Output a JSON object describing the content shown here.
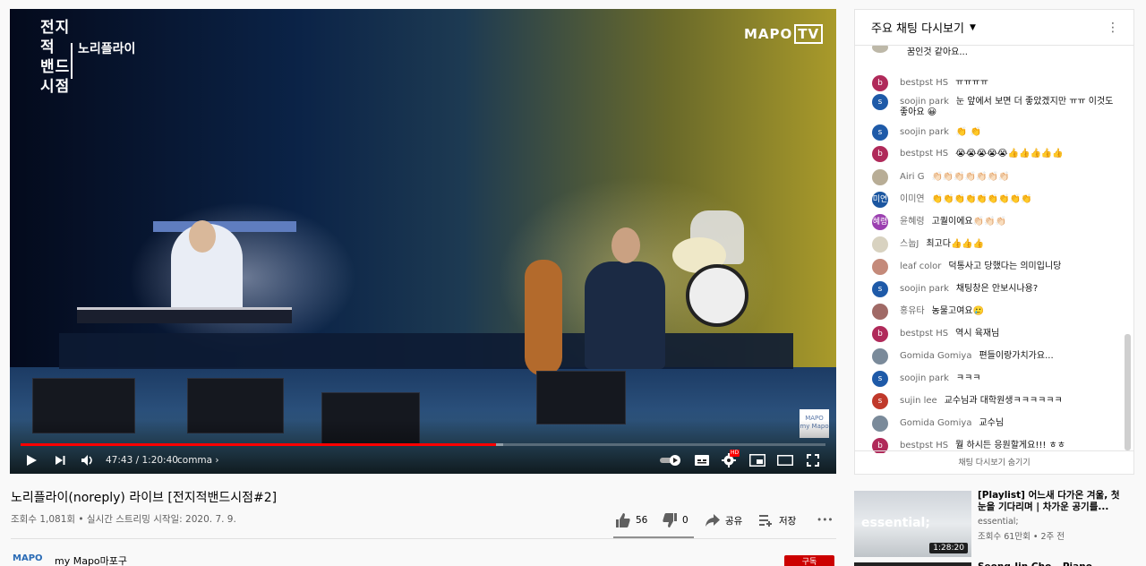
{
  "video": {
    "overlay_title": [
      "전지적",
      "밴드",
      "시점"
    ],
    "overlay_subtitle": "노리플라이",
    "channel_logo": "MAPO",
    "channel_logo_box": "TV",
    "watermark": "MAPO my Mapo",
    "time": "47:43 / 1:20:40",
    "chapter": "comma",
    "progress_played_fraction": 0.591,
    "progress_loaded_fraction": 0.6,
    "hd_badge": "HD"
  },
  "chat": {
    "header": "주요 채팅 다시보기",
    "footer": "채팅 다시보기 숨기기",
    "messages": [
      {
        "author": "",
        "text": "꿈인것 같아요...",
        "avatar_color": "#bdb8a8",
        "avatar": ""
      },
      {
        "author": "bestpst HS",
        "text": "ㅠㅠㅠㅠ",
        "avatar_color": "#b02a5a",
        "avatar": "b"
      },
      {
        "author": "soojin park",
        "text": "눈 앞에서 보면 더 좋았겠지만 ㅠㅠ 이것도 좋아요 😀",
        "avatar_color": "#1e5aa8",
        "avatar": "s"
      },
      {
        "author": "soojin park",
        "text": "👏 👏",
        "avatar_color": "#1e5aa8",
        "avatar": "s"
      },
      {
        "author": "bestpst HS",
        "text": "😭😭😭😭😭👍👍👍👍👍",
        "avatar_color": "#b02a5a",
        "avatar": "b"
      },
      {
        "author": "Airi G",
        "text": "👏🏻👏🏻👏🏻👏🏻👏🏻👏🏻👏🏻",
        "avatar_color": "#b8ad96",
        "avatar": ""
      },
      {
        "author": "이미연",
        "text": "👏👏👏👏👏👏👏👏👏",
        "avatar_color": "#1b56a0",
        "avatar": "미연"
      },
      {
        "author": "윤혜령",
        "text": "고퀄이에요👏🏻👏🏻👏🏻",
        "avatar_color": "#9b3fb0",
        "avatar": "혜령"
      },
      {
        "author": "스눕J",
        "text": "최고다👍👍👍",
        "avatar_color": "#d8d2c0",
        "avatar": ""
      },
      {
        "author": "leaf color",
        "text": "덕통사고 당했다는 의미입니당",
        "avatar_color": "#c48a7a",
        "avatar": ""
      },
      {
        "author": "soojin park",
        "text": "채팅창은 안보시나용?",
        "avatar_color": "#1e5aa8",
        "avatar": "s"
      },
      {
        "author": "홍유타",
        "text": "농물고여요🥲",
        "avatar_color": "#a06a66",
        "avatar": ""
      },
      {
        "author": "bestpst HS",
        "text": "역시 육재님",
        "avatar_color": "#b02a5a",
        "avatar": "b"
      },
      {
        "author": "Gomida Gomiya",
        "text": "편들이랑가치가요...",
        "avatar_color": "#7a8a9a",
        "avatar": ""
      },
      {
        "author": "soojin park",
        "text": "ㅋㅋㅋ",
        "avatar_color": "#1e5aa8",
        "avatar": "s"
      },
      {
        "author": "sujin lee",
        "text": "교수님과 대학원생ㅋㅋㅋㅋㅋㅋ",
        "avatar_color": "#c0392b",
        "avatar": "s"
      },
      {
        "author": "Gomida Gomiya",
        "text": "교수님",
        "avatar_color": "#7a8a9a",
        "avatar": ""
      },
      {
        "author": "bestpst HS",
        "text": "뭘 하시든 응원할게요!!! ㅎㅎ",
        "avatar_color": "#b02a5a",
        "avatar": "b"
      }
    ]
  },
  "info": {
    "title": "노리플라이(noreply) 라이브 [전지적밴드시점#2]",
    "meta": "조회수 1,081회 • 실시간 스트리밍 시작일: 2020. 7. 9.",
    "likes": "56",
    "dislikes": "0",
    "share": "공유",
    "save": "저장",
    "channel_name": "my Mapo마포구",
    "channel_avatar": "MAPO",
    "subscribe": "구독"
  },
  "related": [
    {
      "title": "[Playlist] 어느새 다가온 겨울, 첫 눈을 기다리며 | 차가운 공기를...",
      "channel": "essential;",
      "meta": "조회수 61만회 • 2주 전",
      "duration": "1:28:20",
      "thumb_text": "essential;"
    },
    {
      "title": "Seong-Jin Cho – Piano"
    }
  ]
}
